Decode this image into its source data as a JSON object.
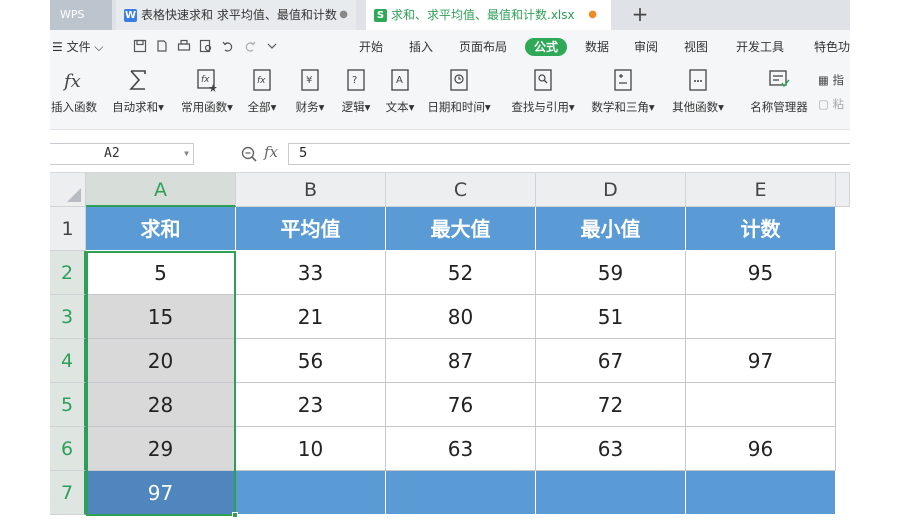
{
  "tabbar": {
    "app_label": "WPS",
    "tabs": [
      {
        "icon": "W",
        "label": "表格快速求和 求平均值、最值和计数",
        "dot": "●"
      },
      {
        "icon": "S",
        "label": "求和、求平均值、最值和计数.xlsx",
        "dot": "●"
      }
    ],
    "add_label": "+"
  },
  "menubar": {
    "file_label": "☰ 文件 ⌵",
    "tabs": [
      "开始",
      "插入",
      "页面布局",
      "公式",
      "数据",
      "审阅",
      "视图",
      "开发工具",
      "特色功"
    ],
    "active_tab": "公式"
  },
  "ribbon": {
    "buttons": [
      {
        "label": "插入函数"
      },
      {
        "label": "自动求和▾"
      },
      {
        "label": "常用函数▾"
      },
      {
        "label": "全部▾"
      },
      {
        "label": "财务▾"
      },
      {
        "label": "逻辑▾"
      },
      {
        "label": "文本▾"
      },
      {
        "label": "日期和时间▾"
      },
      {
        "label": "查找与引用▾"
      },
      {
        "label": "数学和三角▾"
      },
      {
        "label": "其他函数▾"
      },
      {
        "label": "名称管理器"
      }
    ],
    "side": [
      "指",
      "粘"
    ]
  },
  "formula_bar": {
    "name_box": "A2",
    "fx_label": "fx",
    "value": "5"
  },
  "sheet": {
    "columns": [
      "A",
      "B",
      "C",
      "D",
      "E"
    ],
    "rows": [
      "1",
      "2",
      "3",
      "4",
      "5",
      "6",
      "7"
    ],
    "header": [
      "求和",
      "平均值",
      "最大值",
      "最小值",
      "计数"
    ],
    "data": [
      [
        "5",
        "33",
        "52",
        "59",
        "95"
      ],
      [
        "15",
        "21",
        "80",
        "51",
        ""
      ],
      [
        "20",
        "56",
        "87",
        "67",
        "97"
      ],
      [
        "28",
        "23",
        "76",
        "72",
        ""
      ],
      [
        "29",
        "10",
        "63",
        "63",
        "96"
      ]
    ],
    "footer": [
      "97",
      "",
      "",
      "",
      ""
    ],
    "selected_column": "A",
    "active_cell": "A2",
    "header_color": "#5b9bd5",
    "accent_color": "#2f9f58"
  }
}
